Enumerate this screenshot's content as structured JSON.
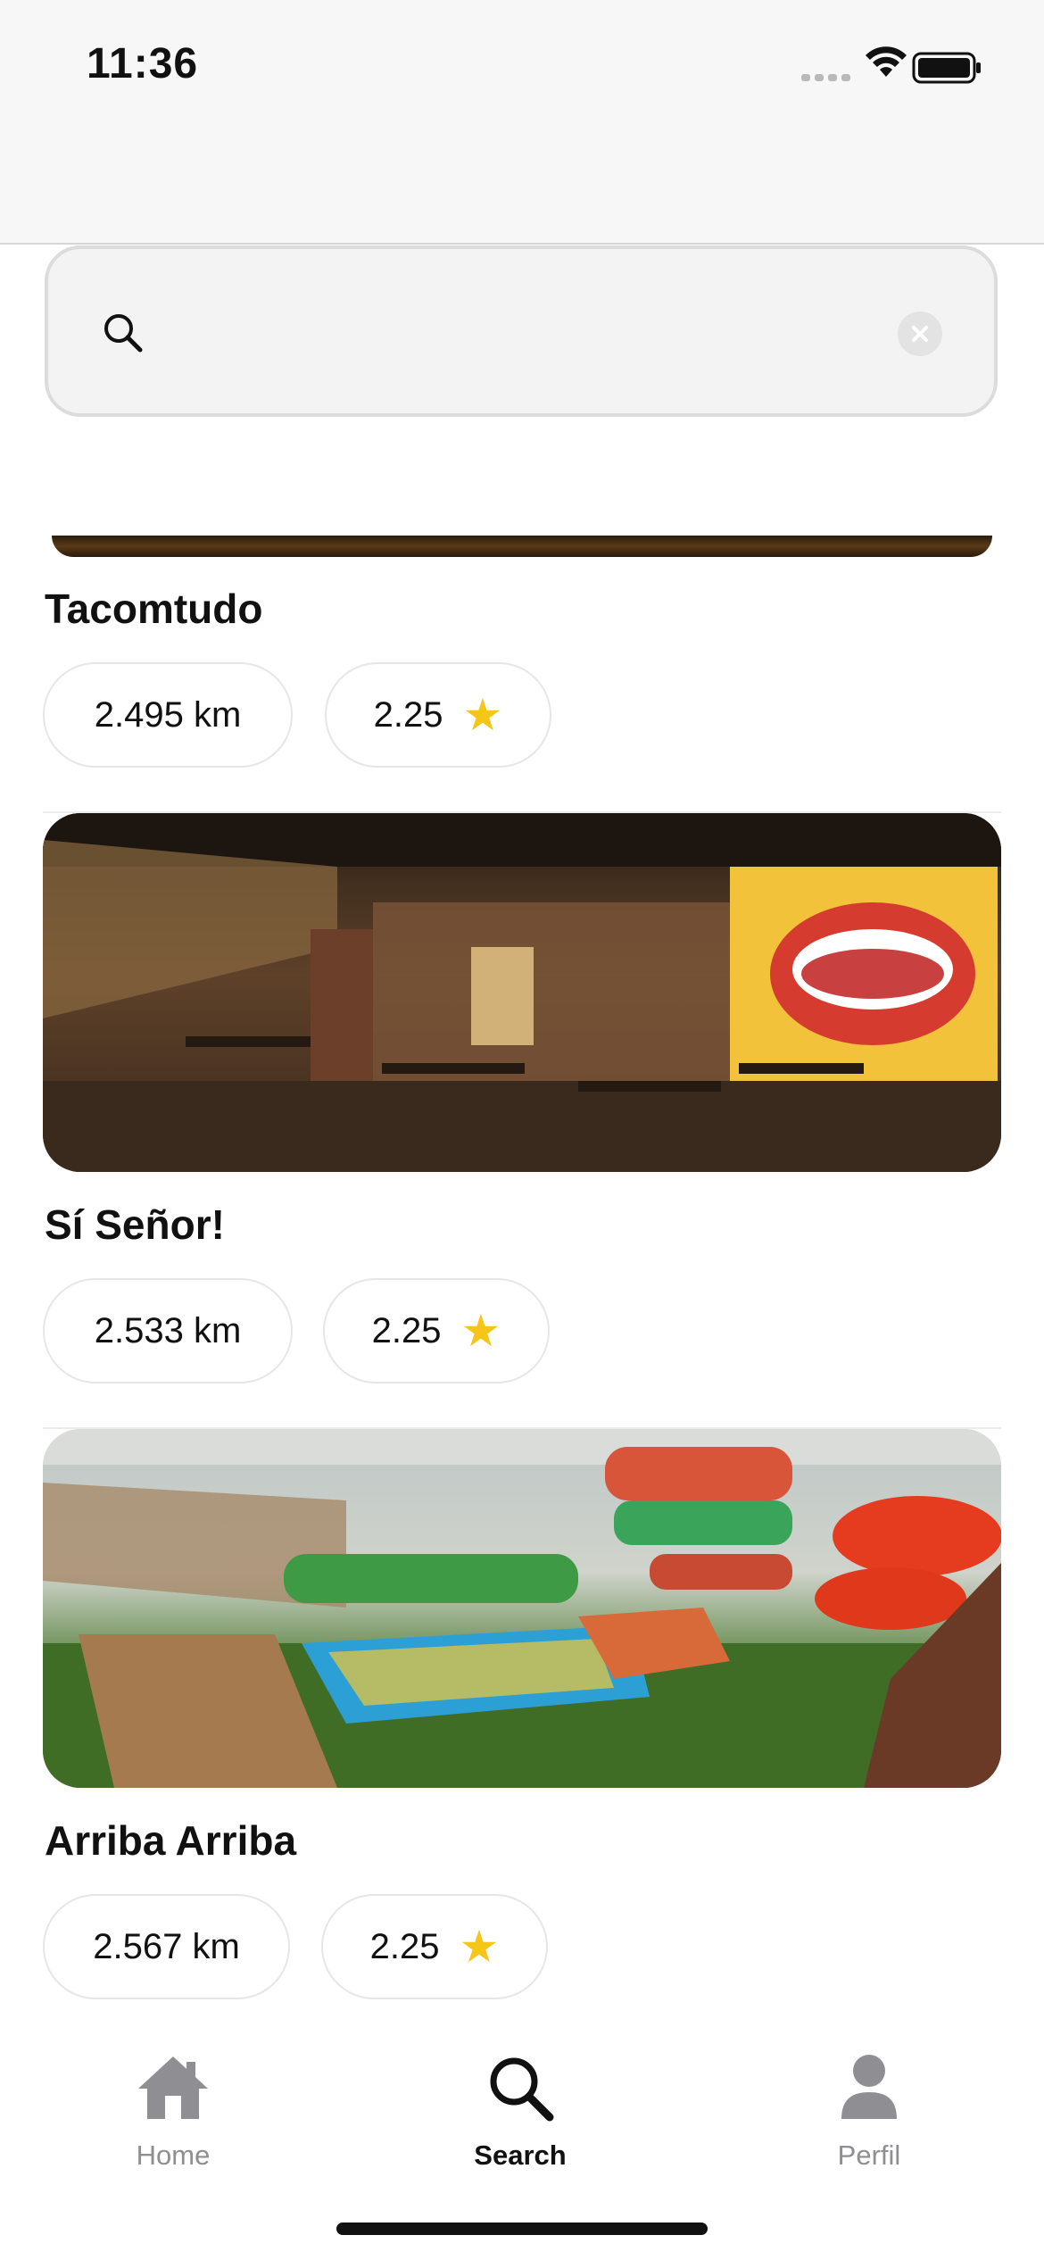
{
  "status_bar": {
    "time": "11:36"
  },
  "search": {
    "value": "",
    "placeholder": ""
  },
  "results": [
    {
      "name": "Tacomtudo",
      "distance": "2.495 km",
      "rating": "2.25"
    },
    {
      "name": "Sí Señor!",
      "distance": "2.533 km",
      "rating": "2.25"
    },
    {
      "name": "Arriba Arriba",
      "distance": "2.567 km",
      "rating": "2.25"
    }
  ],
  "tab_bar": {
    "tabs": [
      {
        "label": "Home",
        "icon": "house-icon",
        "active": false
      },
      {
        "label": "Search",
        "icon": "magnifier-icon",
        "active": true
      },
      {
        "label": "Perfil",
        "icon": "person-icon",
        "active": false
      }
    ]
  },
  "colors": {
    "star": "#f5c518",
    "tab_inactive": "#8e8e93",
    "tab_active": "#111111",
    "header_bg": "#f7f7f7"
  }
}
